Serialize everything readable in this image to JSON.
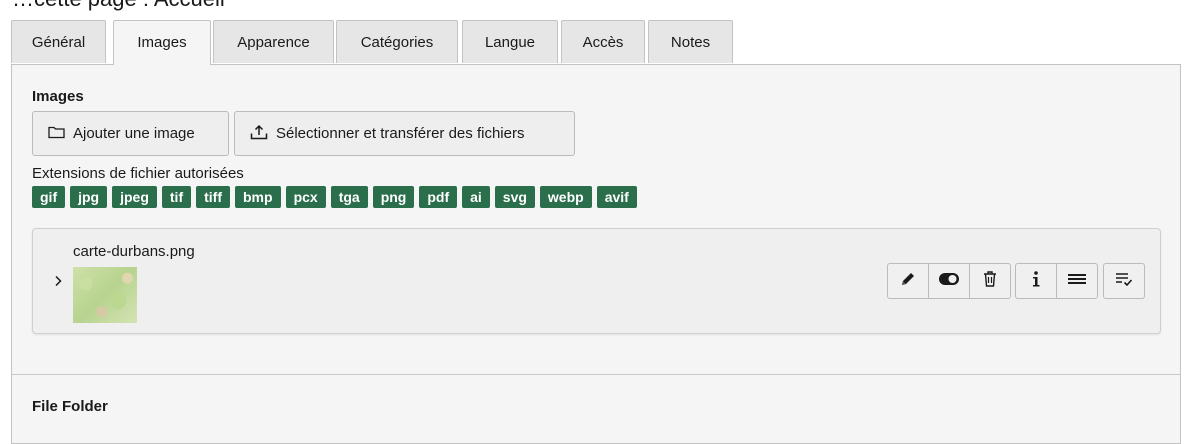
{
  "page": {
    "title_fragment": "…cette page : Accueil"
  },
  "tabs": [
    {
      "label": "Général"
    },
    {
      "label": "Images"
    },
    {
      "label": "Apparence"
    },
    {
      "label": "Catégories"
    },
    {
      "label": "Langue"
    },
    {
      "label": "Accès"
    },
    {
      "label": "Notes"
    }
  ],
  "active_tab": "Images",
  "images_section": {
    "title": "Images",
    "add_button": {
      "label": "Ajouter une image",
      "icon": "folder-icon"
    },
    "upload_button": {
      "label": "Sélectionner et transférer des fichiers",
      "icon": "upload-icon"
    },
    "extensions_label": "Extensions de fichier autorisées",
    "extensions": [
      "gif",
      "jpg",
      "jpeg",
      "tif",
      "tiff",
      "bmp",
      "pcx",
      "tga",
      "png",
      "pdf",
      "ai",
      "svg",
      "webp",
      "avif"
    ],
    "file": {
      "name": "carte-durbans.png",
      "actions": [
        "pencil-icon",
        "toggle-icon",
        "trash-icon",
        "info-icon",
        "menu-icon",
        "list-check-icon"
      ]
    }
  },
  "file_folder_section": {
    "title": "File Folder"
  },
  "colors": {
    "badge": "#2a6e4b",
    "panel": "#f5f5f5",
    "tab": "#e6e6e6"
  }
}
